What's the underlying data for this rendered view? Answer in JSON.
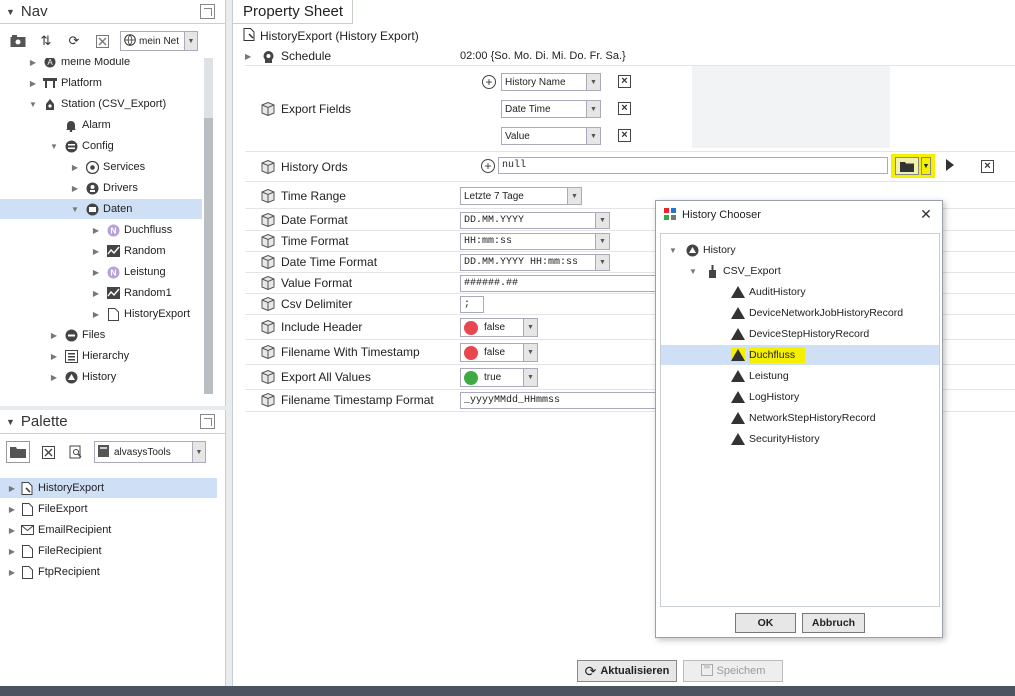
{
  "nav": {
    "title": "Nav",
    "station_selector": "mein Net",
    "tree": [
      {
        "label": "meine Module",
        "icon": "module-icon",
        "indent": 1,
        "expander": "▶"
      },
      {
        "label": "Platform",
        "icon": "platform-icon",
        "indent": 1,
        "expander": "▶"
      },
      {
        "label": "Station (CSV_Export)",
        "icon": "station-icon",
        "indent": 1,
        "expander": "▼"
      },
      {
        "label": "Alarm",
        "icon": "bell-icon",
        "indent": 2,
        "expander": ""
      },
      {
        "label": "Config",
        "icon": "database-icon",
        "indent": 2,
        "expander": "▼"
      },
      {
        "label": "Services",
        "icon": "services-icon",
        "indent": 3,
        "expander": "▶"
      },
      {
        "label": "Drivers",
        "icon": "drivers-icon",
        "indent": 3,
        "expander": "▶"
      },
      {
        "label": "Daten",
        "icon": "folder-icon",
        "indent": 3,
        "expander": "▼"
      },
      {
        "label": "Duchfluss",
        "icon": "numeric-point-icon",
        "indent": 4,
        "expander": "▶"
      },
      {
        "label": "Random",
        "icon": "trend-icon",
        "indent": 4,
        "expander": "▶"
      },
      {
        "label": "Leistung",
        "icon": "numeric-point-icon",
        "indent": 4,
        "expander": "▶"
      },
      {
        "label": "Random1",
        "icon": "trend-icon",
        "indent": 4,
        "expander": "▶"
      },
      {
        "label": "HistoryExport",
        "icon": "document-icon",
        "indent": 4,
        "expander": "▶"
      },
      {
        "label": "Files",
        "icon": "files-icon",
        "indent": 2,
        "expander": "▶"
      },
      {
        "label": "Hierarchy",
        "icon": "hierarchy-icon",
        "indent": 2,
        "expander": "▶"
      },
      {
        "label": "History",
        "icon": "history-icon",
        "indent": 2,
        "expander": "▶"
      }
    ]
  },
  "palette": {
    "title": "Palette",
    "module_selector": "alvasysTools",
    "items": [
      {
        "label": "HistoryExport",
        "icon": "history-export-icon"
      },
      {
        "label": "FileExport",
        "icon": "document-icon"
      },
      {
        "label": "EmailRecipient",
        "icon": "envelope-icon"
      },
      {
        "label": "FileRecipient",
        "icon": "document-icon"
      },
      {
        "label": "FtpRecipient",
        "icon": "document-icon"
      }
    ]
  },
  "sheet": {
    "tab": "Property Sheet",
    "title": "HistoryExport  (History Export)",
    "schedule": {
      "label": "Schedule",
      "value": "02:00 {So. Mo. Di. Mi. Do. Fr. Sa.}"
    },
    "export_fields": {
      "label": "Export Fields",
      "fields": [
        "History Name",
        "Date Time",
        "Value"
      ]
    },
    "history_ords": {
      "label": "History Ords",
      "value": "null"
    },
    "time_range": {
      "label": "Time Range",
      "value": "Letzte 7 Tage"
    },
    "date_format": {
      "label": "Date Format",
      "value": "DD.MM.YYYY"
    },
    "time_format": {
      "label": "Time Format",
      "value": "HH:mm:ss"
    },
    "date_time_format": {
      "label": "Date Time Format",
      "value": "DD.MM.YYYY HH:mm:ss"
    },
    "value_format": {
      "label": "Value Format",
      "value": "######.##"
    },
    "csv_delimiter": {
      "label": "Csv Delimiter",
      "value": ";"
    },
    "include_header": {
      "label": "Include Header",
      "value": "false"
    },
    "filename_with_timestamp": {
      "label": "Filename With Timestamp",
      "value": "false"
    },
    "export_all_values": {
      "label": "Export All Values",
      "value": "true"
    },
    "filename_timestamp_format": {
      "label": "Filename Timestamp Format",
      "value": "_yyyyMMdd_HHmmss"
    },
    "refresh_label": "Aktualisieren",
    "save_label": "Speichem"
  },
  "dialog": {
    "title": "History Chooser",
    "root": "History",
    "station": "CSV_Export",
    "items": [
      "AuditHistory",
      "DeviceNetworkJobHistoryRecord",
      "DeviceStepHistoryRecord",
      "Duchfluss",
      "Leistung",
      "LogHistory",
      "NetworkStepHistoryRecord",
      "SecurityHistory"
    ],
    "selected": "Duchfluss",
    "ok_label": "OK",
    "cancel_label": "Abbruch"
  },
  "colors": {
    "selection": "#cfe0f6",
    "highlight": "#f4f000",
    "false_dot": "#e8474d",
    "true_dot": "#3daa44"
  }
}
